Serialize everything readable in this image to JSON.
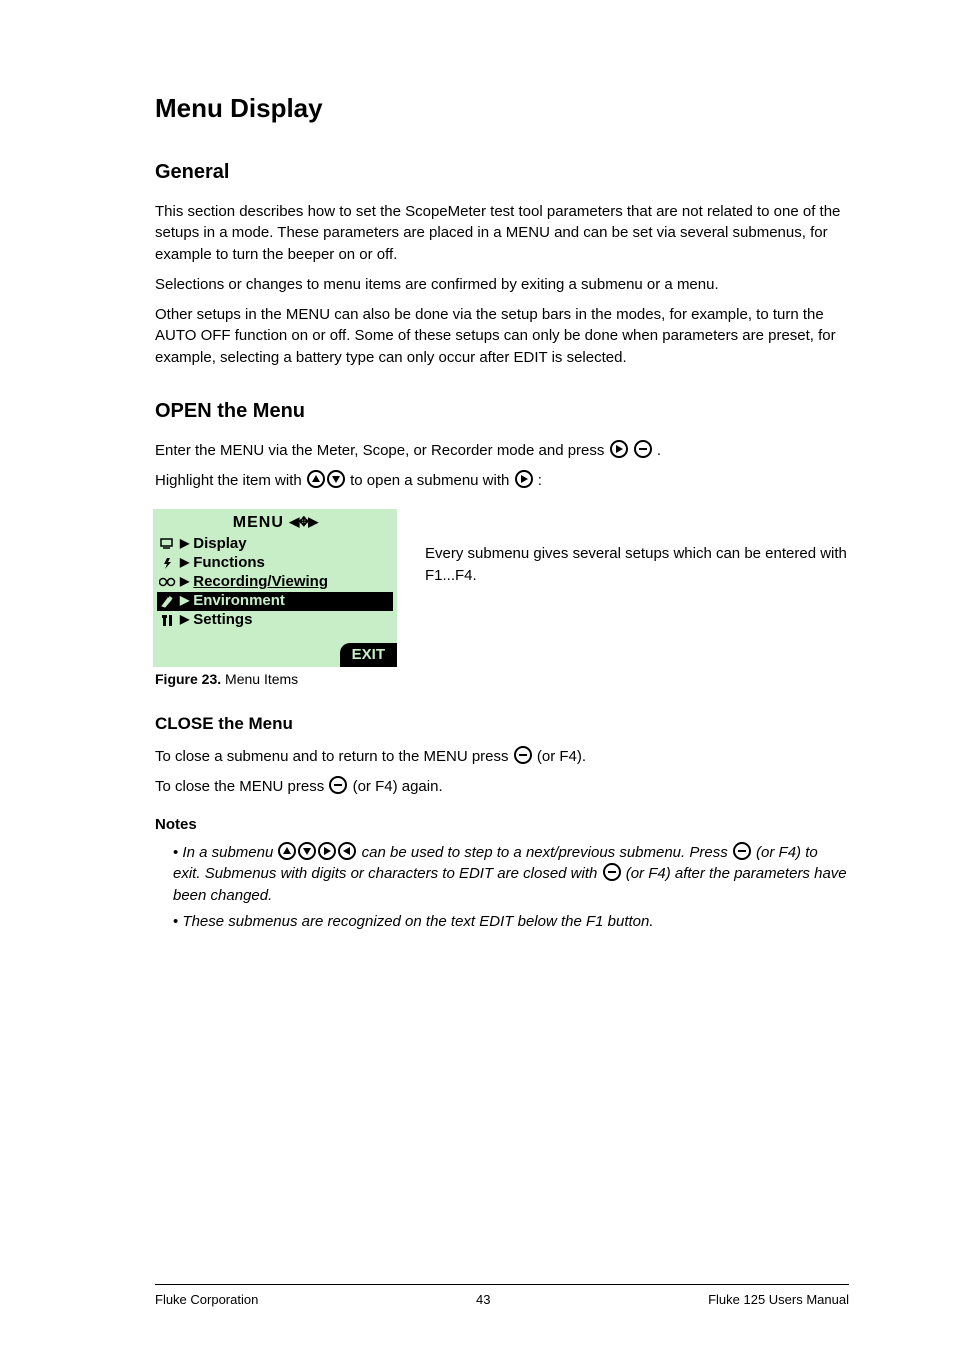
{
  "header": {
    "title": "Menu Display"
  },
  "section_general": {
    "title": "General",
    "p1": "This section describes how to set the ScopeMeter test tool parameters that are not related to one of the setups in a mode. These parameters are placed in a MENU and can be set via several submenus, for example to turn the beeper on or off.",
    "p2": "Selections or changes to menu items are confirmed by exiting a submenu or a menu.",
    "p3": "Other setups in the MENU can also be done via the setup bars in the modes, for example, to turn the AUTO OFF function on or off. Some of these setups can only be done when parameters are preset, for example, selecting a battery type can only occur after EDIT is selected."
  },
  "section_open": {
    "title": "OPEN the Menu",
    "p1_a": "Enter the MENU via the Meter, Scope, or Recorder mode and press ",
    "p1_b": ".",
    "menu_lead": "Highlight the item with ",
    "menu_mid": " to open a submenu with ",
    "menu_end": ":"
  },
  "lcd": {
    "title": "MENU",
    "arrows": "◀✥▶",
    "items": [
      {
        "icon": "display-icon",
        "label": "Display",
        "selected": false,
        "underline": false
      },
      {
        "icon": "bolt-icon",
        "label": "Functions",
        "selected": false,
        "underline": false
      },
      {
        "icon": "tape-icon",
        "label": "Recording/Viewing",
        "selected": false,
        "underline": true
      },
      {
        "icon": "probe-icon",
        "label": "Environment",
        "selected": true,
        "underline": false
      },
      {
        "icon": "tools-icon",
        "label": "Settings",
        "selected": false,
        "underline": false
      }
    ],
    "exit": "EXIT"
  },
  "figure": {
    "label": "Figure 23.",
    "caption": " Menu Items"
  },
  "submenu_text": "Every submenu gives several setups which can be entered with F1...F4.",
  "section_close": {
    "title": "CLOSE the Menu",
    "p1_a": "To close a submenu and to return to the MENU press ",
    "p1_b": " (or F4).",
    "p2_a": "To close the MENU press ",
    "p2_b": " (or F4) again."
  },
  "notes": {
    "title": "Notes",
    "n1_a": "In a submenu ",
    "n1_b": " can be used to step to a next/previous submenu. Press ",
    "n1_c": " (or F4) to exit. ",
    "n2_a": "Submenus with digits or characters to EDIT are closed with ",
    "n2_b": " (or F4) after the parameters have been changed. ",
    "n2_c": "These submenus are recognized on the text EDIT below the F1 button. "
  },
  "footer": {
    "left": "Fluke Corporation",
    "center": "43",
    "right": "Fluke 125 Users Manual"
  },
  "icons": {
    "right": "▶",
    "enter": "−",
    "up": "▲",
    "down": "▼",
    "left": "◀"
  }
}
